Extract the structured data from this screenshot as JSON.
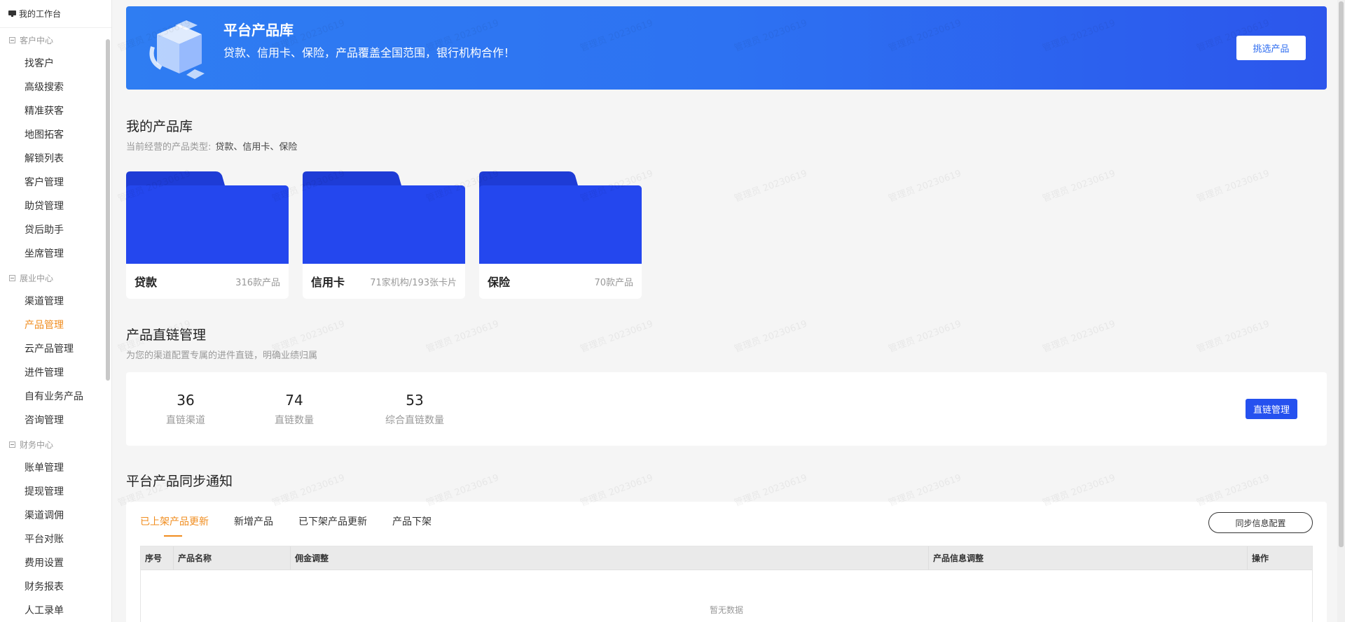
{
  "sidebar": {
    "workspace": "我的工作台",
    "groups": [
      {
        "label": "客户中心",
        "items": [
          "找客户",
          "高级搜索",
          "精准获客",
          "地图拓客",
          "解锁列表",
          "客户管理",
          "助贷管理",
          "贷后助手",
          "坐席管理"
        ]
      },
      {
        "label": "展业中心",
        "items": [
          "渠道管理",
          "产品管理",
          "云产品管理",
          "进件管理",
          "自有业务产品",
          "咨询管理"
        ]
      },
      {
        "label": "财务中心",
        "items": [
          "账单管理",
          "提现管理",
          "渠道调佣",
          "平台对账",
          "费用设置",
          "财务报表",
          "人工录单"
        ]
      }
    ],
    "active_item": "产品管理"
  },
  "banner": {
    "title": "平台产品库",
    "subtitle": "贷款、信用卡、保险，产品覆盖全国范围，银行机构合作！",
    "button": "挑选产品"
  },
  "my_library": {
    "title": "我的产品库",
    "subtitle_label": "当前经营的产品类型:",
    "subtitle_value": "贷款、信用卡、保险",
    "folders": [
      {
        "name": "贷款",
        "count": "316款产品"
      },
      {
        "name": "信用卡",
        "count": "71家机构/193张卡片"
      },
      {
        "name": "保险",
        "count": "70款产品"
      }
    ]
  },
  "direct_link": {
    "title": "产品直链管理",
    "subtitle": "为您的渠道配置专属的进件直链，明确业绩归属",
    "stats": [
      {
        "value": "36",
        "label": "直链渠道"
      },
      {
        "value": "74",
        "label": "直链数量"
      },
      {
        "value": "53",
        "label": "综合直链数量"
      }
    ],
    "button": "直链管理"
  },
  "sync": {
    "title": "平台产品同步通知",
    "tabs": [
      "已上架产品更新",
      "新增产品",
      "已下架产品更新",
      "产品下架"
    ],
    "active_tab": "已上架产品更新",
    "button": "同步信息配置",
    "columns": [
      "序号",
      "产品名称",
      "佣金调整",
      "产品信息调整",
      "操作"
    ],
    "empty_text": "暂无数据"
  },
  "watermark": "管理员 20230619",
  "colors": {
    "accent": "#f08c1e",
    "primary": "#2551ef",
    "banner_start": "#2f7df2",
    "banner_end": "#2c56ec",
    "folder": "#2447ee",
    "folder_tab": "#1e3cd6"
  }
}
